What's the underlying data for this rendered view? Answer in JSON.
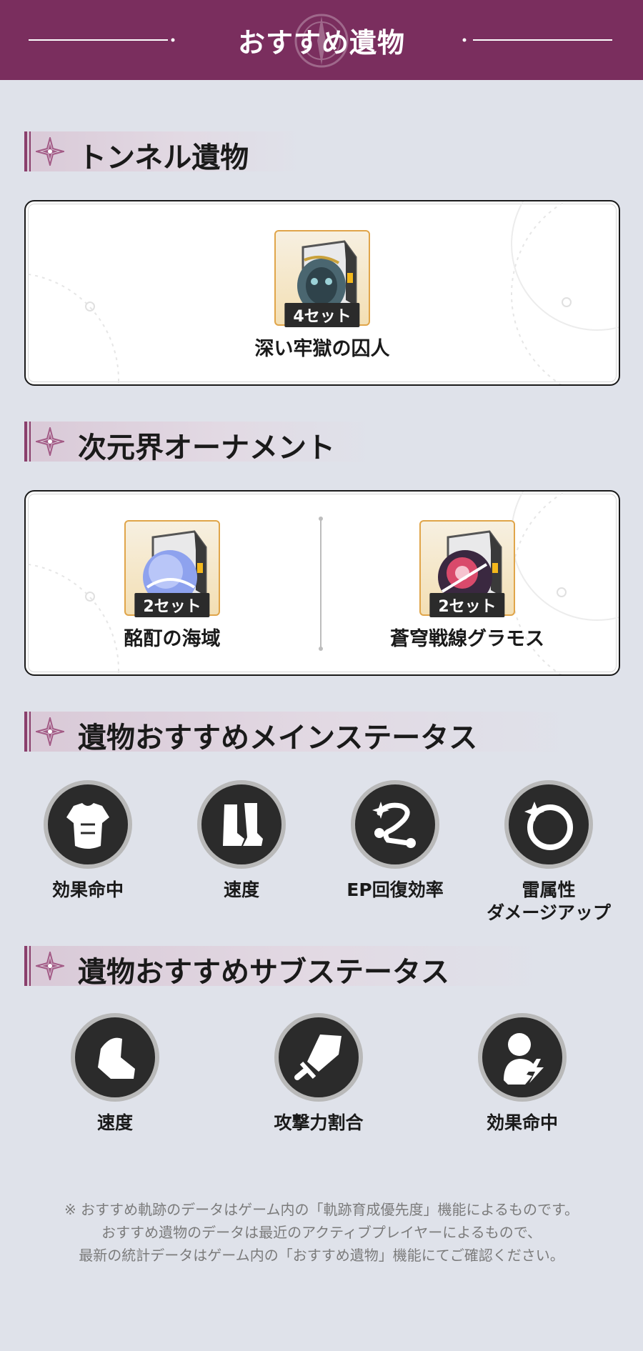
{
  "header": {
    "title": "おすすめ遺物"
  },
  "sections": {
    "tunnel": {
      "title": "トンネル遺物"
    },
    "planar": {
      "title": "次元界オーナメント"
    },
    "main_stats": {
      "title": "遺物おすすめメインステータス"
    },
    "sub_stats": {
      "title": "遺物おすすめサブステータス"
    }
  },
  "tunnel_relics": [
    {
      "badge": "4セット",
      "name": "深い牢獄の囚人",
      "icon": "prisoner-relic-icon"
    }
  ],
  "planar_relics": [
    {
      "badge": "2セット",
      "name": "酩酊の海域",
      "icon": "sea-of-intoxication-icon"
    },
    {
      "badge": "2セット",
      "name": "蒼穹戦線グラモス",
      "icon": "firmament-frontline-icon"
    }
  ],
  "main_stats": [
    {
      "label": "効果命中",
      "icon": "body-armor-icon"
    },
    {
      "label": "速度",
      "icon": "boots-icon"
    },
    {
      "label": "EP回復効率",
      "icon": "link-rope-icon"
    },
    {
      "label": "雷属性",
      "label2": "ダメージアップ",
      "icon": "planar-sphere-icon"
    }
  ],
  "sub_stats": [
    {
      "label": "速度",
      "icon": "speed-boot-icon"
    },
    {
      "label": "攻撃力割合",
      "icon": "sword-icon"
    },
    {
      "label": "効果命中",
      "icon": "effect-hit-icon"
    }
  ],
  "note": {
    "line1": "※ おすすめ軌跡のデータはゲーム内の「軌跡育成優先度」機能によるものです。",
    "line2": "おすすめ遺物のデータは最近のアクティブプレイヤーによるもので、",
    "line3": "最新の統計データはゲーム内の「おすすめ遺物」機能にてご確認ください。"
  },
  "colors": {
    "header_bg": "#7a2e5e",
    "page_bg": "#dfe2ea",
    "accent": "#8a3f6c",
    "badge_bg": "#2b2b2b"
  }
}
